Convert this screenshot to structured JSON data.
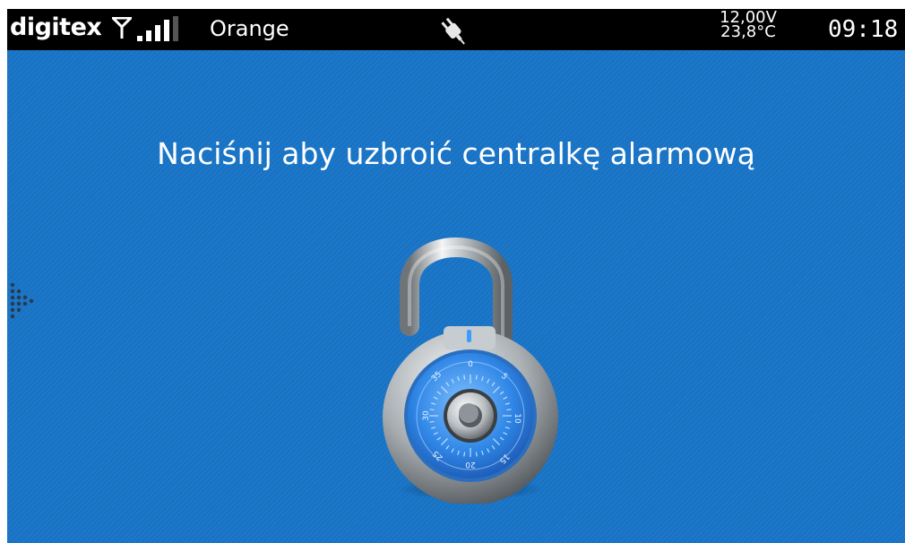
{
  "status_bar": {
    "brand": "digitex",
    "operator": "Orange",
    "voltage": "12,00V",
    "temperature": "23,8°C",
    "time": "09:18",
    "icons": {
      "antenna": "antenna-icon",
      "signal": "signal-strength-icon",
      "power": "power-plug-icon"
    }
  },
  "main": {
    "prompt": "Naciśnij aby uzbroić centralkę alarmową",
    "lock_icon": "open-padlock-icon",
    "dial_numbers": [
      "0",
      "5",
      "10",
      "15",
      "20",
      "25",
      "30",
      "35"
    ],
    "menu_handle_icon": "dotted-arrow-icon"
  },
  "colors": {
    "background": "#1873c5",
    "status_bar": "#000000",
    "text": "#ffffff",
    "dial_blue": "#2f86e6"
  }
}
